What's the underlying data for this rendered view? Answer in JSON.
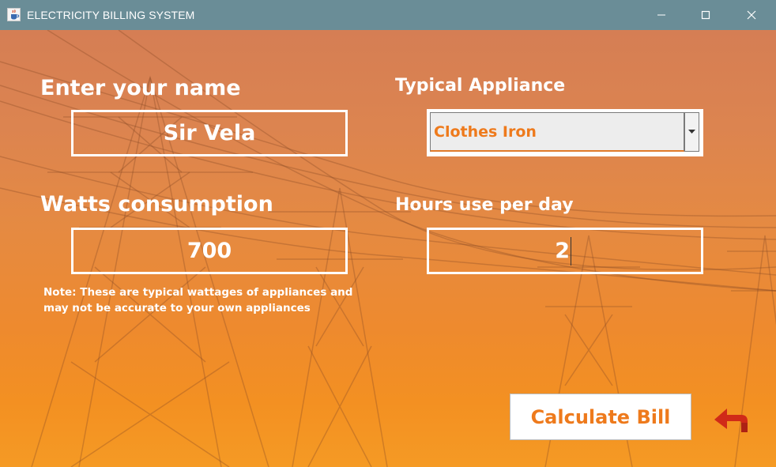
{
  "window": {
    "title": "ELECTRICITY BILLING SYSTEM",
    "app_icon": "java-cup-icon",
    "controls": [
      "minimize-icon",
      "maximize-icon",
      "close-icon"
    ]
  },
  "form": {
    "name_label": "Enter your name",
    "name_value": "Sir Vela",
    "watts_label": "Watts consumption",
    "watts_value": "700",
    "appliance_label": "Typical Appliance",
    "appliance_selected": "Clothes Iron",
    "hours_label": "Hours use per day",
    "hours_value": "2",
    "note": "Note: These are typical wattages of appliances and may not be accurate to your own appliances"
  },
  "actions": {
    "calculate_label": "Calculate Bill",
    "back_icon": "back-arrow-icon"
  },
  "colors": {
    "titlebar": "#6a8d97",
    "accent": "#ee7a1c",
    "back_arrow": "#d02a18"
  }
}
